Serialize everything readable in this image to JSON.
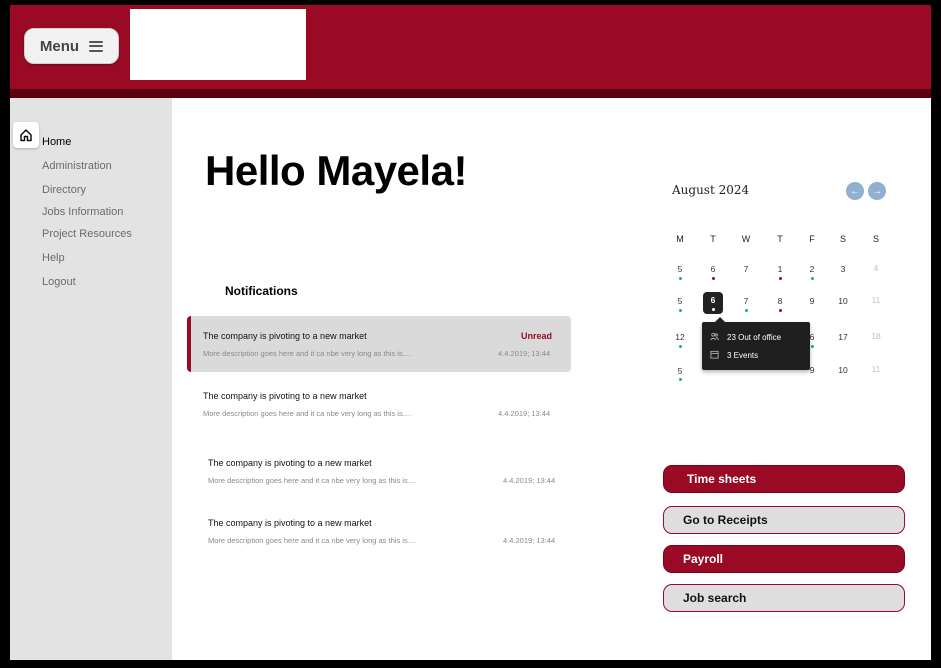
{
  "header": {
    "menu_label": "Menu"
  },
  "sidebar": {
    "items": [
      {
        "label": "Home"
      },
      {
        "label": "Administration"
      },
      {
        "label": "Directory"
      },
      {
        "label": "Jobs Information"
      },
      {
        "label": "Project Resources"
      },
      {
        "label": "Help"
      },
      {
        "label": "Logout"
      }
    ]
  },
  "main": {
    "greeting": "Hello Mayela!",
    "notifications_title": "Notifications",
    "notifications": [
      {
        "title": "The company is pivoting to a new market",
        "description": "More description goes here and it ca nbe very long as this is....",
        "date": "4.4.2019; 13:44",
        "status": "Unread"
      },
      {
        "title": "The company is pivoting to a new market",
        "description": "More description goes here and it ca nbe very long as this is....",
        "date": "4.4.2019; 13:44",
        "status": ""
      },
      {
        "title": "The company is pivoting to a new market",
        "description": "More description goes here and it ca nbe very long as this is....",
        "date": "4.4.2019; 13:44",
        "status": ""
      },
      {
        "title": "The company is pivoting to a new market",
        "description": "More description goes here and it ca nbe very long as this is....",
        "date": "4.4.2019; 13:44",
        "status": ""
      }
    ]
  },
  "calendar": {
    "month_label": "August 2024",
    "prev_icon": "arrow-left-icon",
    "next_icon": "arrow-right-icon",
    "weekdays": [
      "M",
      "T",
      "W",
      "T",
      "F",
      "S",
      "S"
    ],
    "rows": [
      [
        "5",
        "6",
        "7",
        "1",
        "2",
        "3",
        "4"
      ],
      [
        "5",
        "6",
        "7",
        "8",
        "9",
        "10",
        "11"
      ],
      [
        "12",
        "",
        "",
        "",
        "6",
        "17",
        "18"
      ],
      [
        "5",
        "",
        "",
        "",
        "9",
        "10",
        "11"
      ]
    ],
    "selected_day": "6",
    "tooltip": {
      "out_of_office": "23 Out of office",
      "events": "3 Events"
    }
  },
  "actions": [
    {
      "label": "Time sheets",
      "style": "primary"
    },
    {
      "label": "Go to Receipts",
      "style": "secondary"
    },
    {
      "label": "Payroll",
      "style": "primary"
    },
    {
      "label": "Job search",
      "style": "secondary"
    }
  ],
  "colors": {
    "brand": "#9a0a24",
    "brand_dark": "#5c0010",
    "sidebar_bg": "#e3e3e3",
    "dot_teal": "#1aa6b3"
  }
}
